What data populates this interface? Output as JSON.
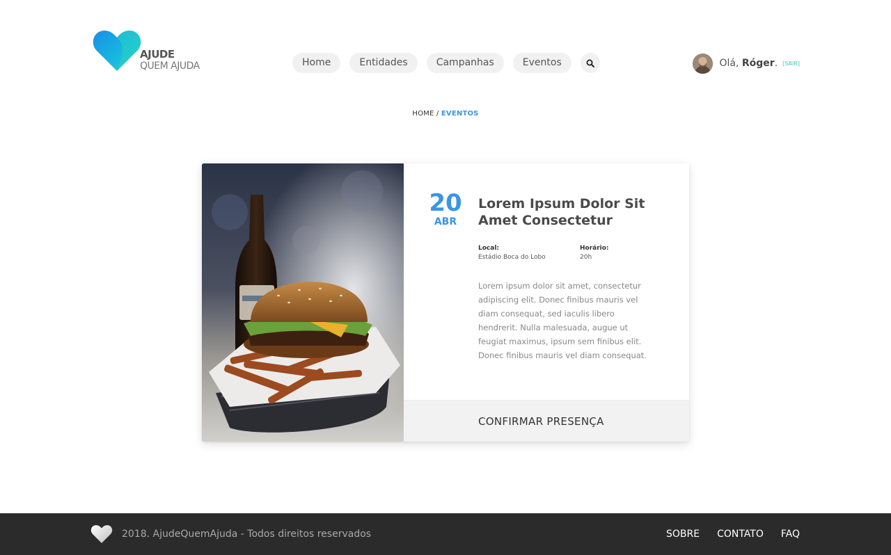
{
  "logo": {
    "title": "AJUDE",
    "subtitle": "QUEM AJUDA"
  },
  "nav": {
    "items": [
      {
        "label": "Home"
      },
      {
        "label": "Entidades"
      },
      {
        "label": "Campanhas"
      },
      {
        "label": "Eventos"
      }
    ],
    "search_icon": "search-icon"
  },
  "user": {
    "greeting": "Olá, ",
    "name": "Róger",
    "suffix": ".",
    "logout": "[SAIR]"
  },
  "breadcrumb": {
    "home": "HOME",
    "separator": "/",
    "current": "EVENTOS"
  },
  "event": {
    "day": "20",
    "month": "ABR",
    "title": "Lorem Ipsum Dolor Sit Amet Consectetur",
    "local_label": "Local:",
    "local_value": "Estádio Boca do Lobo",
    "time_label": "Horário:",
    "time_value": "20h",
    "description": "Lorem ipsum dolor sit amet, consectetur adipiscing elit. Donec finibus mauris vel diam consequat, sed iaculis libero hendrerit. Nulla malesuada, augue ut feugiat maximus, ipsum sem finibus elit. Donec finibus mauris vel diam consequat.",
    "confirm_label": "CONFIRMAR PRESENÇA"
  },
  "footer": {
    "copyright": "2018. AjudeQuemAjuda - Todos direitos reservados",
    "links": [
      {
        "label": "SOBRE"
      },
      {
        "label": "CONTATO"
      },
      {
        "label": "FAQ"
      }
    ]
  },
  "colors": {
    "accent": "#3b95e6",
    "teal": "#2ed0b5",
    "footer_bg": "#2b2b2b",
    "pill_bg": "#f1f1f1"
  }
}
